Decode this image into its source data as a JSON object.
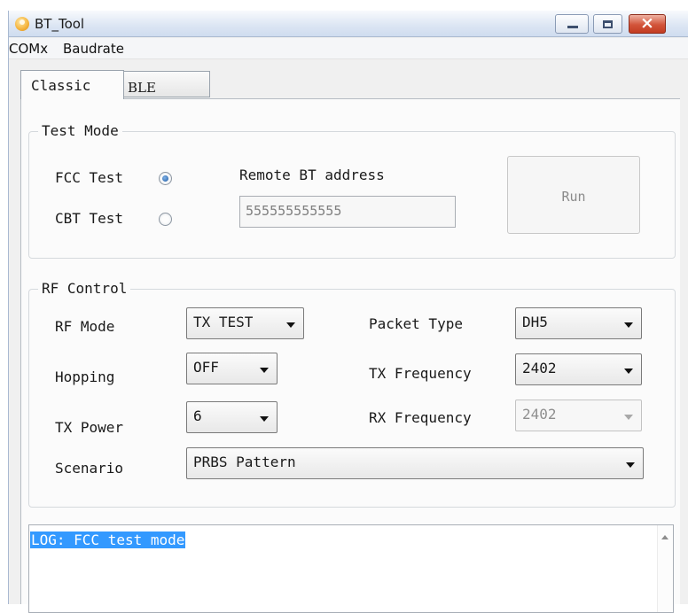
{
  "window": {
    "title": "BT_Tool",
    "icon": "app-person-icon"
  },
  "menu": {
    "items": [
      "COMx",
      "Baudrate"
    ]
  },
  "tabs": [
    {
      "label": "Classic",
      "selected": true
    },
    {
      "label": "BLE",
      "selected": false
    }
  ],
  "test_mode": {
    "title": "Test Mode",
    "fcc_label": "FCC Test",
    "fcc_checked": true,
    "cbt_label": "CBT Test",
    "cbt_checked": false,
    "remote_label": "Remote BT address",
    "remote_value": "555555555555",
    "run_label": "Run"
  },
  "rf_control": {
    "title": "RF Control",
    "rf_mode": {
      "label": "RF Mode",
      "value": "TX TEST"
    },
    "hopping": {
      "label": "Hopping",
      "value": "OFF"
    },
    "tx_power": {
      "label": "TX Power",
      "value": "6"
    },
    "scenario": {
      "label": "Scenario",
      "value": "PRBS Pattern"
    },
    "packet_type": {
      "label": "Packet Type",
      "value": "DH5"
    },
    "tx_frequency": {
      "label": "TX Frequency",
      "value": "2402"
    },
    "rx_frequency": {
      "label": "RX Frequency",
      "value": "2402",
      "enabled": false
    }
  },
  "log": {
    "text": "LOG: FCC test mode",
    "highlight_color": "#3399ff"
  }
}
